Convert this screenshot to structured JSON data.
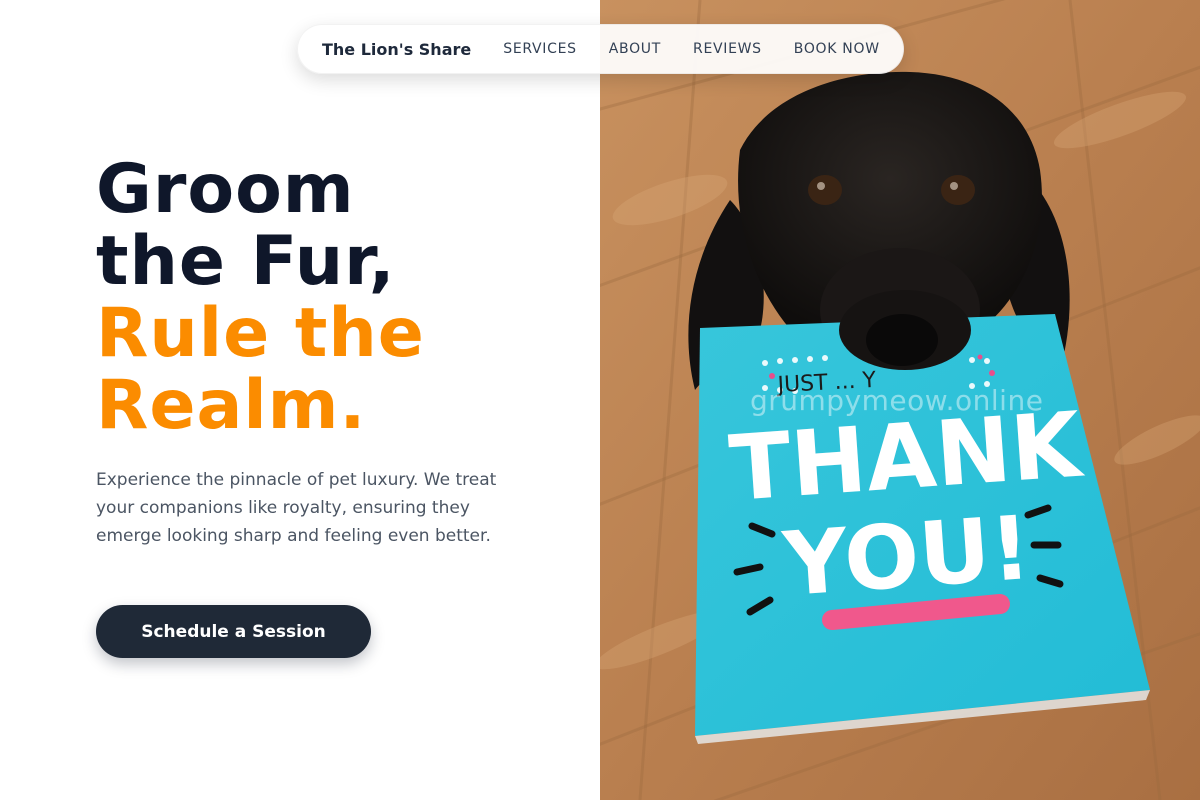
{
  "nav": {
    "brand": "The Lion's Share",
    "links": [
      "SERVICES",
      "ABOUT",
      "REVIEWS",
      "BOOK NOW"
    ]
  },
  "hero": {
    "title_line1": "Groom",
    "title_line2": "the Fur,",
    "title_line3": "Rule the",
    "title_line4": "Realm.",
    "subtitle": "Experience the pinnacle of pet luxury. We treat your companions like royalty, ensuring they emerge looking sharp and feeling even better.",
    "cta_label": "Schedule a Session"
  },
  "photo": {
    "card_small_text": "JUST ... Y",
    "card_line1": "THANK",
    "card_line2": "YOU!",
    "watermark": "grumpymeow.online"
  },
  "colors": {
    "accent": "#fb8c00",
    "heading": "#0f172a",
    "button": "#1f2937",
    "card": "#2cc3d9"
  }
}
